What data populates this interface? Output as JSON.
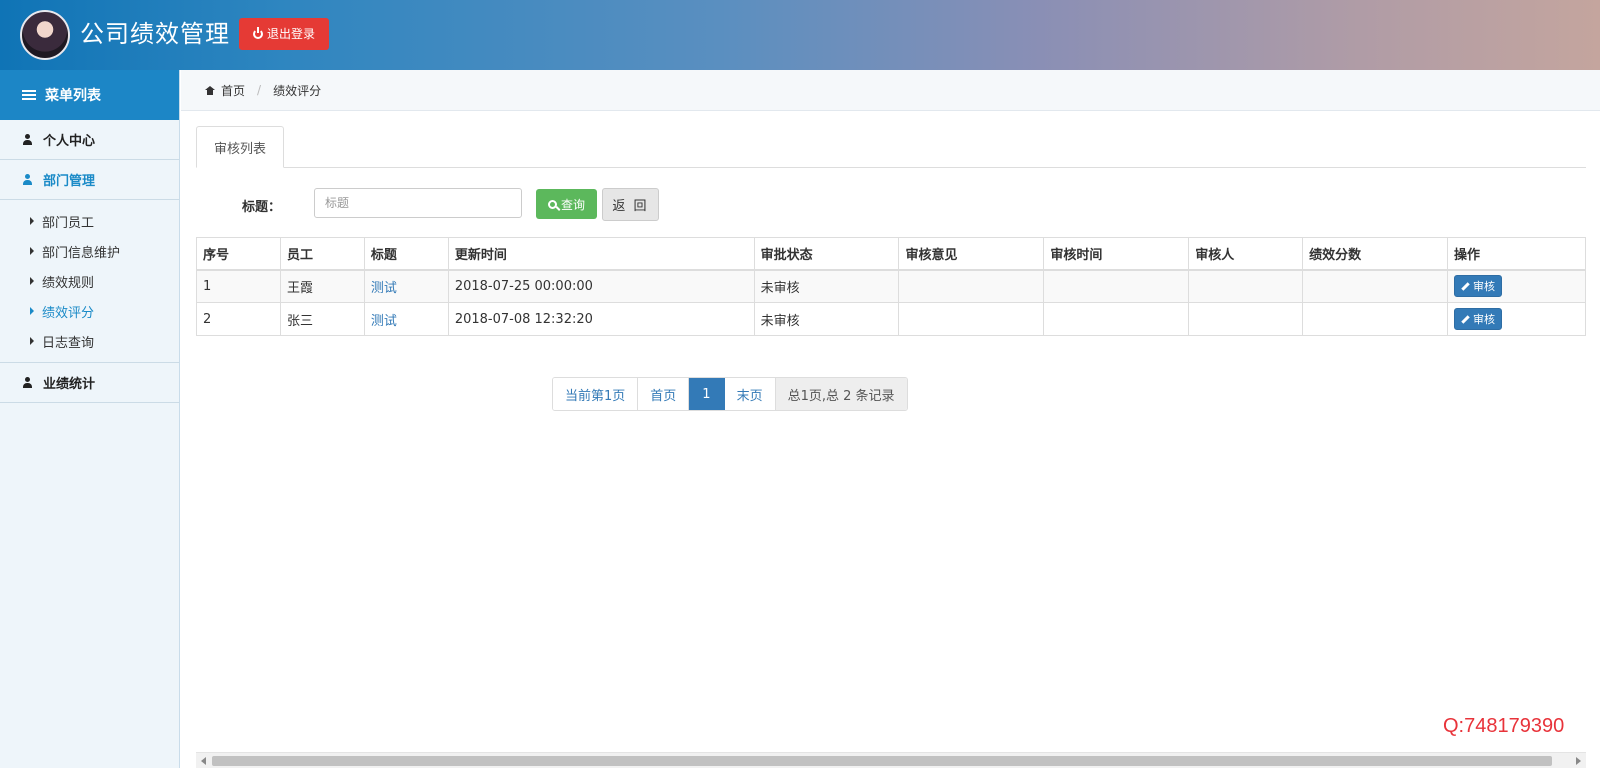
{
  "header": {
    "app_title": "公司绩效管理",
    "logout_label": "退出登录"
  },
  "sidebar": {
    "title": "菜单列表",
    "items": [
      {
        "label": "个人中心",
        "icon": "user-icon",
        "active": false
      },
      {
        "label": "部门管理",
        "icon": "user-icon",
        "active": true
      },
      {
        "label": "业绩统计",
        "icon": "user-icon",
        "active": false
      }
    ],
    "subitems": [
      {
        "label": "部门员工",
        "active": false
      },
      {
        "label": "部门信息维护",
        "active": false
      },
      {
        "label": "绩效规则",
        "active": false
      },
      {
        "label": "绩效评分",
        "active": true
      },
      {
        "label": "日志查询",
        "active": false
      }
    ]
  },
  "breadcrumb": {
    "home": "首页",
    "current": "绩效评分"
  },
  "tabs": {
    "active": "审核列表"
  },
  "search": {
    "label": "标题：",
    "placeholder": "标题",
    "value": "",
    "search_label": "查询",
    "back_label": "返 回"
  },
  "table": {
    "headers": [
      "序号",
      "员工",
      "标题",
      "更新时间",
      "审批状态",
      "审核意见",
      "审核时间",
      "审核人",
      "绩效分数",
      "操作"
    ],
    "rows": [
      {
        "no": "1",
        "employee": "王霞",
        "title": "测试",
        "updated": "2018-07-25 00:00:00",
        "status": "未审核",
        "opinion": "",
        "review_time": "",
        "reviewer": "",
        "score": "",
        "action": "审核"
      },
      {
        "no": "2",
        "employee": "张三",
        "title": "测试",
        "updated": "2018-07-08 12:32:20",
        "status": "未审核",
        "opinion": "",
        "review_time": "",
        "reviewer": "",
        "score": "",
        "action": "审核"
      }
    ]
  },
  "pagination": {
    "current_label": "当前第1页",
    "first": "首页",
    "page": "1",
    "last": "末页",
    "summary": "总1页,总 2 条记录"
  },
  "watermark": "Q:748179390",
  "colors": {
    "accent": "#1c86c6",
    "logout": "#e53a35",
    "search_button": "#5cb85c",
    "primary": "#337ab7",
    "watermark": "#e8333a"
  }
}
